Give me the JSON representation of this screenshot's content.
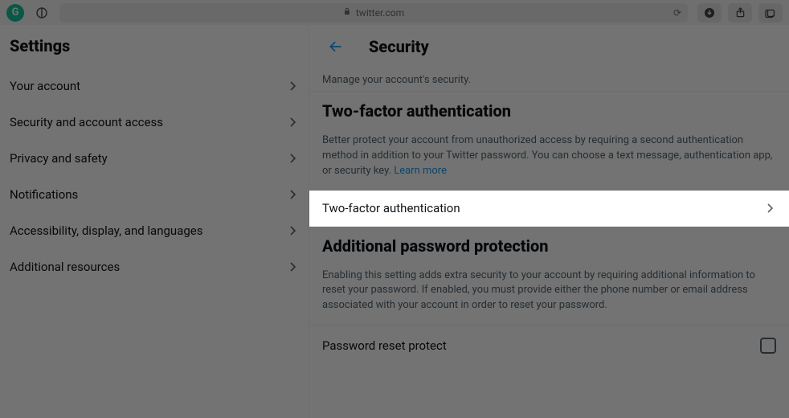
{
  "toolbar": {
    "url_domain": "twitter.com"
  },
  "sidebar": {
    "title": "Settings",
    "items": [
      {
        "label": "Your account"
      },
      {
        "label": "Security and account access"
      },
      {
        "label": "Privacy and safety"
      },
      {
        "label": "Notifications"
      },
      {
        "label": "Accessibility, display, and languages"
      },
      {
        "label": "Additional resources"
      }
    ]
  },
  "main": {
    "title": "Security",
    "subtitle": "Manage your account's security.",
    "tfa": {
      "heading": "Two-factor authentication",
      "desc": "Better protect your account from unauthorized access by requiring a second authentication method in addition to your Twitter password. You can choose a text message, authentication app, or security key. ",
      "learn_more": "Learn more",
      "row_label": "Two-factor authentication"
    },
    "app": {
      "heading": "Additional password protection",
      "desc": "Enabling this setting adds extra security to your account by requiring additional information to reset your password. If enabled, you must provide either the phone number or email address associated with your account in order to reset your password.",
      "checkbox_label": "Password reset protect"
    }
  },
  "colors": {
    "link": "#1d9bf0",
    "text_secondary": "#536471"
  }
}
